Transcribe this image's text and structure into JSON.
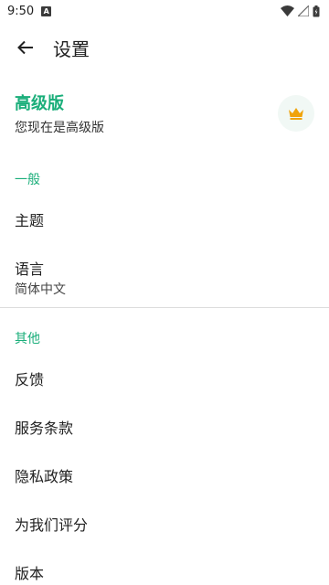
{
  "status_bar": {
    "time": "9:50",
    "notification_icon": "A"
  },
  "app_bar": {
    "title": "设置",
    "back_icon": "arrow-left-icon"
  },
  "premium": {
    "title": "高级版",
    "subtitle": "您现在是高级版",
    "icon": "crown-icon",
    "accent_color": "#1aae7a",
    "crown_color": "#f0a30a"
  },
  "sections": {
    "general": {
      "header": "一般",
      "theme": "主题",
      "language": "语言",
      "language_value": "简体中文"
    },
    "other": {
      "header": "其他",
      "feedback": "反馈",
      "terms": "服务条款",
      "privacy": "隐私政策",
      "rate": "为我们评分",
      "version": "版本"
    }
  }
}
